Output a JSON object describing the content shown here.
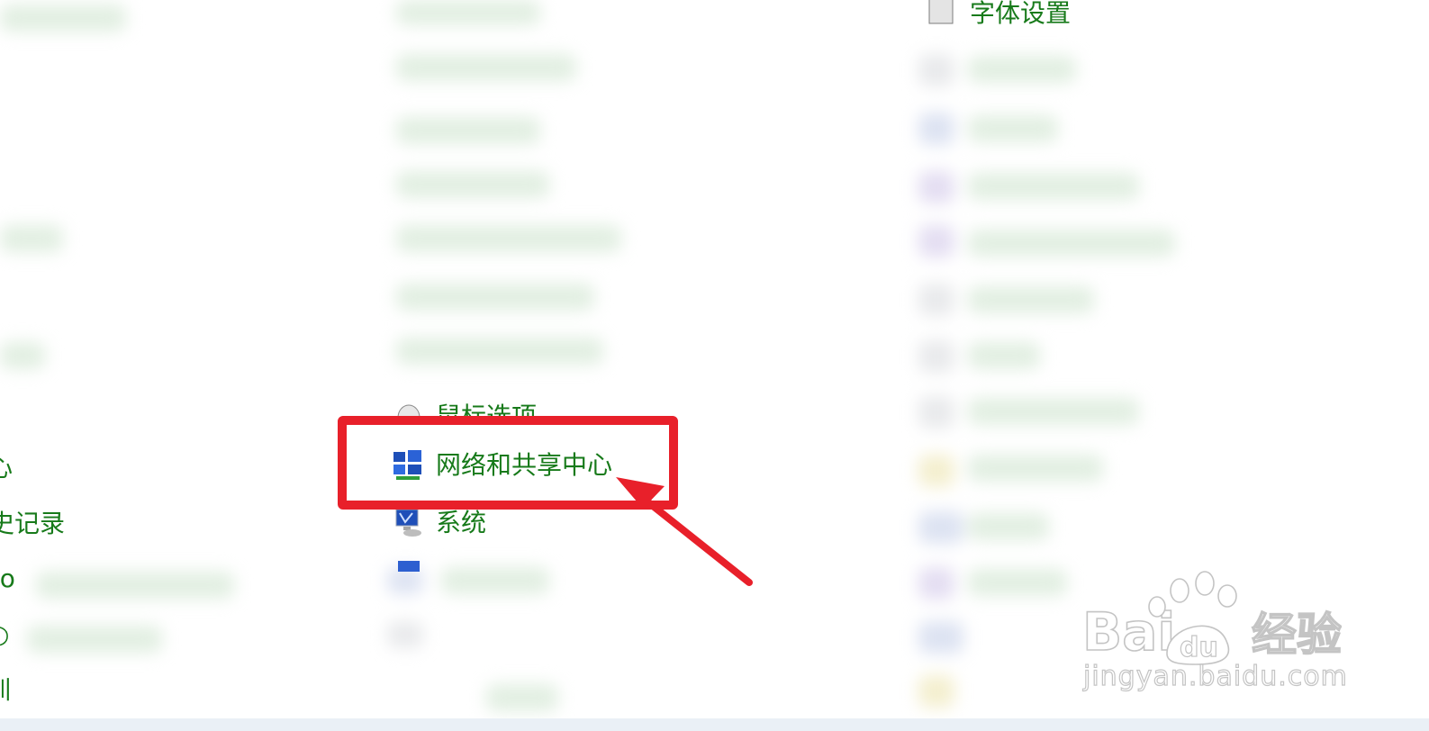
{
  "links": {
    "top_right_partial": "字体设置",
    "left_partial_center": "心",
    "left_partial_history": "史记录",
    "left_partial_windows": "lo",
    "left_partial_circle": "○",
    "left_partial_bottom": "训",
    "above_partial": "鼠标选项",
    "network_sharing_center": "网络和共享中心",
    "system": "系统"
  },
  "annotation": {
    "highlight_color": "#e8202a",
    "arrow_color": "#e8202a"
  },
  "watermark": {
    "brand": "Bai du 经验",
    "url": "jingyan.baidu.com"
  },
  "colors": {
    "link_green": "#177a1a",
    "background": "#ffffff"
  }
}
